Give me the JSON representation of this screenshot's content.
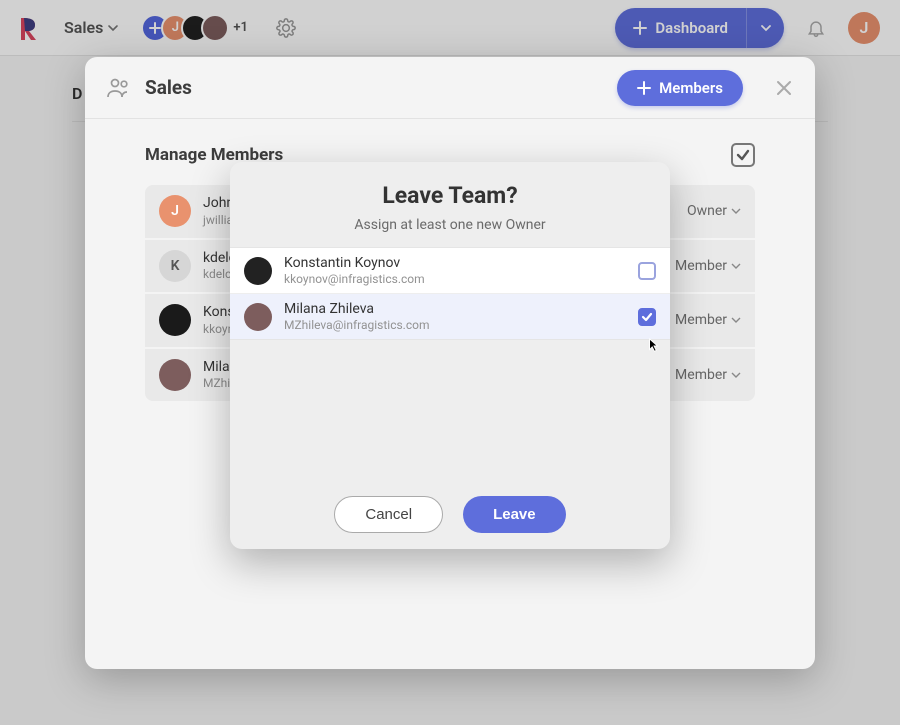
{
  "topbar": {
    "workspace_label": "Sales",
    "avatar_more": "+1",
    "dashboard_label": "Dashboard",
    "profile_initial": "J",
    "avatar1_initial": "J"
  },
  "page": {
    "title_first_letter": "D"
  },
  "panel": {
    "title": "Sales",
    "members_button": "Members",
    "manage_title": "Manage Members",
    "rows": [
      {
        "initial": "J",
        "name": "John",
        "email": "jwilliam",
        "role": "Owner",
        "avatar_bg": "#e9926e"
      },
      {
        "initial": "K",
        "name": "kdelc",
        "email": "kdelc",
        "role": "Member",
        "avatar_bg": "#d6d6d6"
      },
      {
        "initial": "",
        "name": "Kons",
        "email": "kkoyn",
        "role": "Member",
        "avatar_bg": "#1a1a1a"
      },
      {
        "initial": "",
        "name": "Milar",
        "email": "MZhil",
        "role": "Member",
        "avatar_bg": "#7d5d5d"
      }
    ]
  },
  "modal": {
    "title": "Leave Team?",
    "subtitle": "Assign at least one new Owner",
    "candidates": [
      {
        "name": "Konstantin Koynov",
        "email": "kkoynov@infragistics.com",
        "checked": false
      },
      {
        "name": "Milana Zhileva",
        "email": "MZhileva@infragistics.com",
        "checked": true
      }
    ],
    "cancel_label": "Cancel",
    "leave_label": "Leave"
  }
}
